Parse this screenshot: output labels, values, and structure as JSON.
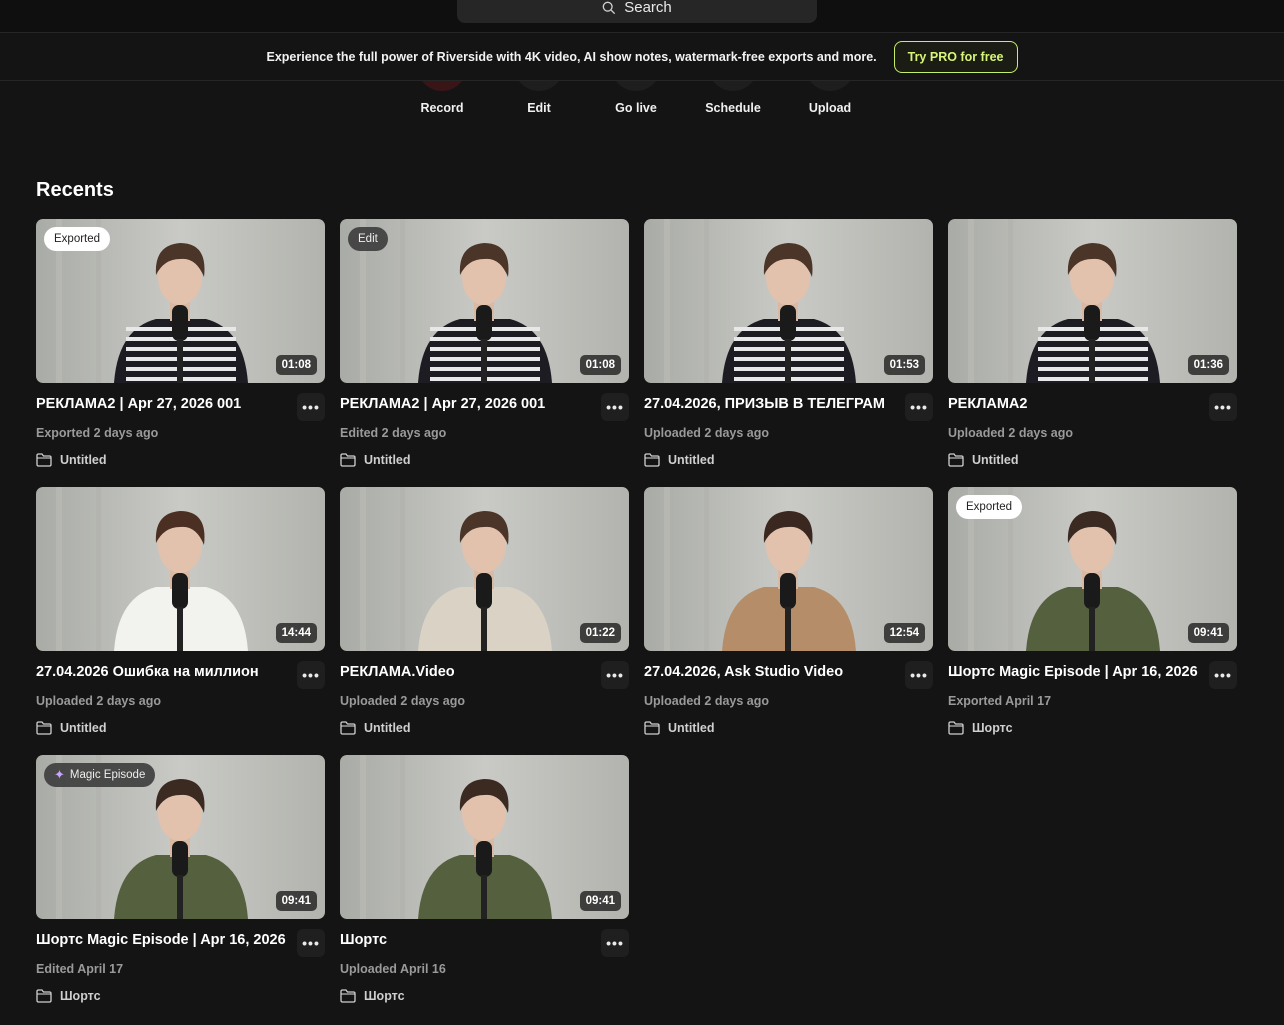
{
  "search": {
    "label": "Search"
  },
  "promo": {
    "text": "Experience the full power of Riverside with 4K video, AI show notes, watermark-free exports and more.",
    "button": "Try PRO for free"
  },
  "actions": [
    {
      "label": "Record"
    },
    {
      "label": "Edit"
    },
    {
      "label": "Go live"
    },
    {
      "label": "Schedule"
    },
    {
      "label": "Upload"
    }
  ],
  "recents": {
    "title": "Recents",
    "items": [
      {
        "title": "РЕКЛАМА2 | Apr 27, 2026 001",
        "status": "Exported 2 days ago",
        "folder": "Untitled",
        "duration": "01:08",
        "badge": "Exported",
        "badge_style": "light",
        "outfit": "stripes"
      },
      {
        "title": "РЕКЛАМА2 | Apr 27, 2026 001",
        "status": "Edited 2 days ago",
        "folder": "Untitled",
        "duration": "01:08",
        "badge": "Edit",
        "badge_style": "dark",
        "outfit": "stripes"
      },
      {
        "title": "27.04.2026, ПРИЗЫВ В ТЕЛЕГРАМ",
        "status": "Uploaded 2 days ago",
        "folder": "Untitled",
        "duration": "01:53",
        "badge": "",
        "badge_style": "",
        "outfit": "stripes"
      },
      {
        "title": "РЕКЛАМА2",
        "status": "Uploaded 2 days ago",
        "folder": "Untitled",
        "duration": "01:36",
        "badge": "",
        "badge_style": "",
        "outfit": "stripes"
      },
      {
        "title": "27.04.2026 Ошибка на миллион",
        "status": "Uploaded 2 days ago",
        "folder": "Untitled",
        "duration": "14:44",
        "badge": "",
        "badge_style": "",
        "outfit": "white"
      },
      {
        "title": "РЕКЛАМА.Video",
        "status": "Uploaded 2 days ago",
        "folder": "Untitled",
        "duration": "01:22",
        "badge": "",
        "badge_style": "",
        "outfit": "beige"
      },
      {
        "title": "27.04.2026, Ask Studio Video",
        "status": "Uploaded 2 days ago",
        "folder": "Untitled",
        "duration": "12:54",
        "badge": "",
        "badge_style": "",
        "outfit": "trench"
      },
      {
        "title": "Шортс Magic Episode | Apr 16, 2026",
        "status": "Exported April 17",
        "folder": "Шортс",
        "duration": "09:41",
        "badge": "Exported",
        "badge_style": "light",
        "outfit": "olive"
      },
      {
        "title": "Шортс Magic Episode | Apr 16, 2026",
        "status": "Edited April 17",
        "folder": "Шортс",
        "duration": "09:41",
        "badge": "Magic Episode",
        "badge_style": "magic",
        "outfit": "olive"
      },
      {
        "title": "Шортс",
        "status": "Uploaded April 16",
        "folder": "Шортс",
        "duration": "09:41",
        "badge": "",
        "badge_style": "",
        "outfit": "olive"
      }
    ]
  },
  "icons": {
    "search": "search-icon",
    "folder": "folder-icon",
    "more": "more-options-icon",
    "sparkle": "sparkle-icon"
  },
  "colors": {
    "background": "#141414",
    "promo_accent": "#c7ee69"
  }
}
